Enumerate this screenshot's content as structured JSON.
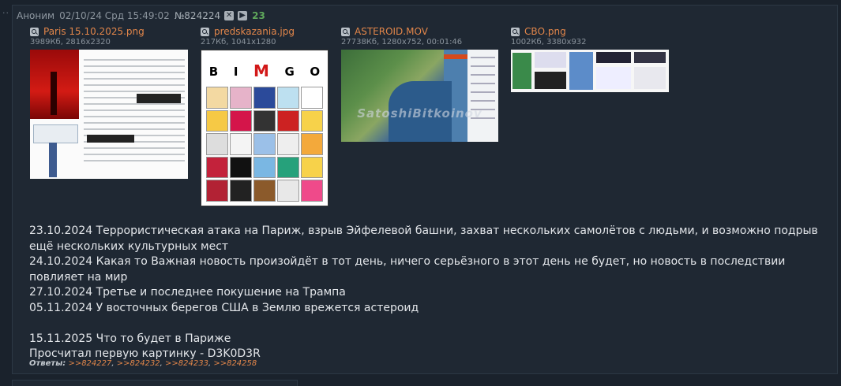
{
  "post": {
    "author": "Аноним",
    "date": "02/10/24 Срд 15:49:02",
    "number": "№824224",
    "replies_count": "23",
    "close_icon": "close-icon",
    "play_icon": "play-icon"
  },
  "files": [
    {
      "name": "Paris 15.10.2025.png",
      "info": "3989Кб, 2816x2320"
    },
    {
      "name": "predskazania.jpg",
      "info": "217Кб, 1041x1280"
    },
    {
      "name": "ASTEROID.MOV",
      "info": "27738Кб, 1280x752, 00:01:46"
    },
    {
      "name": "СВО.png",
      "info": "1002Кб, 3380x932"
    }
  ],
  "bingo": {
    "letters": [
      "B",
      "I",
      "M",
      "G",
      "O"
    ]
  },
  "video_watermark": "SatoshiBitkoinov",
  "message": {
    "lines": [
      "23.10.2024 Террористическая атака на Париж, взрыв Эйфелевой башни, захват нескольких самолётов с людьми, и возможно подрыв ещё нескольких культурных мест",
      "24.10.2024 Какая то Важная новость произойдёт в тот день, ничего серьёзного в этот день не будет, но новость в последствии повлияет на мир",
      "27.10.2024 Третье и последнее покушение на Трампа",
      "05.11.2024 У восточных берегов США в Землю врежется астероид",
      "",
      "15.11.2025 Что то будет в Париже",
      "Просчитал первую картинку - D3K0D3R"
    ]
  },
  "replies": {
    "label": "Ответы:",
    "refs": [
      ">>824227",
      ">>824232",
      ">>824233",
      ">>824258"
    ]
  }
}
